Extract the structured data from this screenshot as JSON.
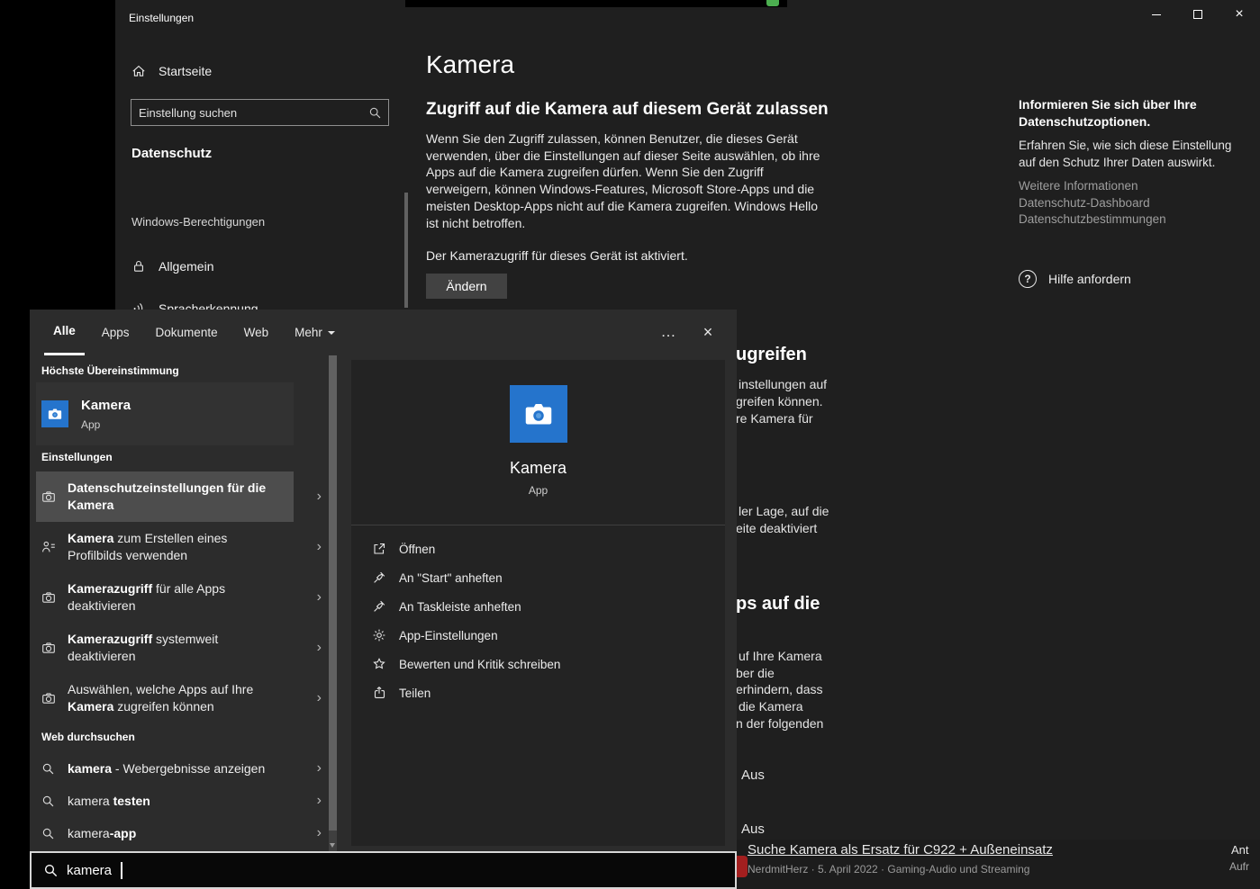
{
  "glyphs": {
    "chevron_right": "›",
    "ellipsis": "…",
    "close": "×",
    "question": "?"
  },
  "window": {
    "title": "Einstellungen"
  },
  "sidebar": {
    "home_label": "Startseite",
    "search_placeholder": "Einstellung suchen",
    "page_title": "Datenschutz",
    "group_label": "Windows-Berechtigungen",
    "items": [
      {
        "label": "Allgemein",
        "icon": "lock-icon"
      },
      {
        "label": "Spracherkennung",
        "icon": "speech-icon"
      }
    ]
  },
  "main": {
    "title": "Kamera",
    "section_heading": "Zugriff auf die Kamera auf diesem Gerät zulassen",
    "body": "Wenn Sie den Zugriff zulassen, können Benutzer, die dieses Gerät verwenden, über die Einstellungen auf dieser Seite auswählen, ob ihre Apps auf die Kamera zugreifen dürfen. Wenn Sie den Zugriff verweigern, können Windows-Features, Microsoft Store-Apps und die meisten Desktop-Apps nicht auf die Kamera zugreifen. Windows Hello ist nicht betroffen.",
    "status_text": "Der Kamerazugriff für dieses Gerät ist aktiviert.",
    "change_button": "Ändern"
  },
  "aside": {
    "heading": "Informieren Sie sich über Ihre Datenschutzoptionen.",
    "description": "Erfahren Sie, wie sich diese Einstellung auf den Schutz Ihrer Daten auswirkt.",
    "links": [
      "Weitere Informationen",
      "Datenschutz-Dashboard",
      "Datenschutzbestimmungen"
    ],
    "help_label": "Hilfe anfordern"
  },
  "background_fragments": [
    "ugreifen",
    "instellungen auf",
    "greifen können.",
    "re Kamera für",
    "ler Lage, auf die",
    "eite deaktiviert",
    "ps auf die",
    "uf Ihre Kamera",
    "ber die",
    "erhindern, dass",
    "die Kamera",
    "n der folgenden",
    "Aus",
    "Aus"
  ],
  "forum": {
    "title": "Suche Kamera als Ersatz für C922 + Außeneinsatz",
    "meta": "NerdmitHerz · 5. April 2022 · Gaming-Audio und Streaming",
    "clipped_col_1": "Ant",
    "clipped_col_2": "Aufr"
  },
  "search": {
    "tabs": [
      {
        "label": "Alle",
        "active": true
      },
      {
        "label": "Apps",
        "active": false
      },
      {
        "label": "Dokumente",
        "active": false
      },
      {
        "label": "Web",
        "active": false
      },
      {
        "label": "Mehr",
        "active": false,
        "has_dropdown": true
      }
    ],
    "best_match_header": "Höchste Übereinstimmung",
    "best_match": {
      "title": "Kamera",
      "subtitle": "App",
      "icon": "camera-app-icon"
    },
    "settings_header": "Einstellungen",
    "settings_results": [
      {
        "pre": "",
        "match": "Datenschutzeinstellungen für die Kamera",
        "post": "",
        "icon": "camera-icon",
        "selected": true
      },
      {
        "pre": "",
        "match": "Kamera",
        "post": " zum Erstellen eines Profilbilds verwenden",
        "icon": "person-icon",
        "selected": false
      },
      {
        "pre": "",
        "match": "Kamerazugriff",
        "post": " für alle Apps deaktivieren",
        "icon": "camera-icon",
        "selected": false
      },
      {
        "pre": "",
        "match": "Kamerazugriff",
        "post": " systemweit deaktivieren",
        "icon": "camera-icon",
        "selected": false
      },
      {
        "pre": "Auswählen, welche Apps auf Ihre ",
        "match": "Kamera",
        "post": " zugreifen können",
        "icon": "camera-icon",
        "selected": false
      }
    ],
    "web_header": "Web durchsuchen",
    "web_results": [
      {
        "pre": "",
        "match": "kamera",
        "post": " - Webergebnisse anzeigen",
        "icon": "search-icon"
      },
      {
        "pre": "kamera ",
        "match": "testen",
        "post": "",
        "icon": "search-icon"
      },
      {
        "pre": "kamera",
        "match": "-app",
        "post": "",
        "icon": "search-icon"
      }
    ],
    "preview": {
      "title": "Kamera",
      "subtitle": "App",
      "actions": [
        {
          "label": "Öffnen",
          "icon": "open-icon"
        },
        {
          "label": "An \"Start\" anheften",
          "icon": "pin-icon"
        },
        {
          "label": "An Taskleiste anheften",
          "icon": "pin-icon"
        },
        {
          "label": "App-Einstellungen",
          "icon": "gear-icon"
        },
        {
          "label": "Bewerten und Kritik schreiben",
          "icon": "rate-icon"
        },
        {
          "label": "Teilen",
          "icon": "share-icon"
        }
      ]
    },
    "input_value": "kamera"
  }
}
